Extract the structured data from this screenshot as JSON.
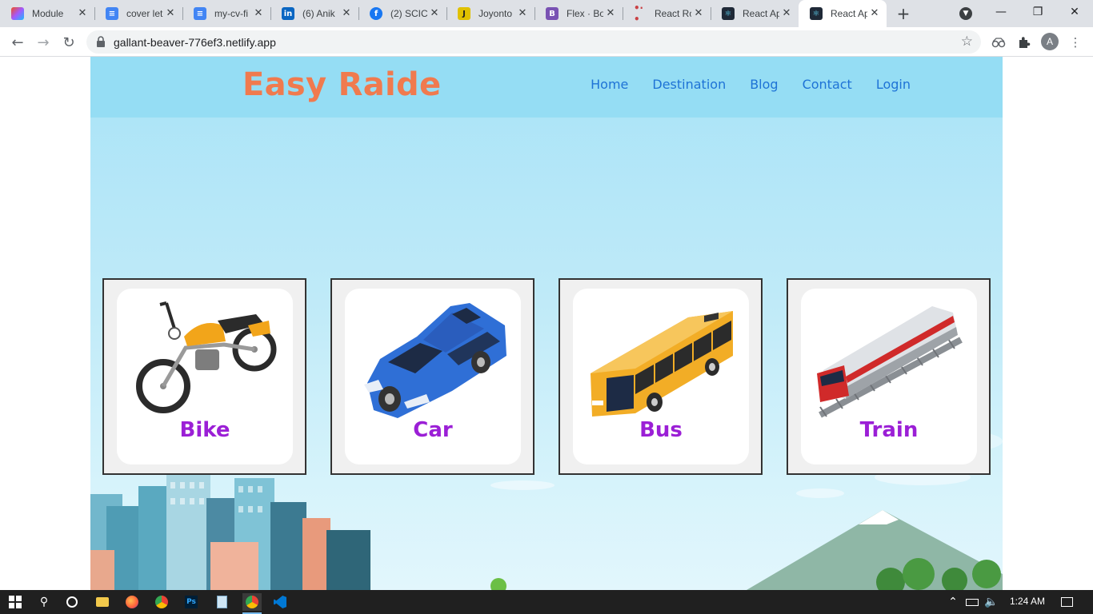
{
  "tabs": [
    {
      "title": "Module",
      "icon": "figma-icon",
      "color": "#a259ff"
    },
    {
      "title": "cover let",
      "icon": "docs-icon",
      "color": "#4285f4"
    },
    {
      "title": "my-cv-fi",
      "icon": "docs-icon",
      "color": "#4285f4"
    },
    {
      "title": "(6) Anik",
      "icon": "linkedin-icon",
      "color": "#0a66c2"
    },
    {
      "title": "(2) SCIC",
      "icon": "facebook-icon",
      "color": "#1877f2"
    },
    {
      "title": "Joyonto",
      "icon": "joyonto-icon",
      "color": "#e0c100"
    },
    {
      "title": "Flex · Bo",
      "icon": "bootstrap-icon",
      "color": "#7952b3"
    },
    {
      "title": "React Ro",
      "icon": "react-router-icon",
      "color": "#ca4245"
    },
    {
      "title": "React Ap",
      "icon": "react-icon",
      "color": "#1f2937"
    },
    {
      "title": "React Ap",
      "icon": "react-icon",
      "color": "#1f2937"
    }
  ],
  "address_bar": {
    "url": "gallant-beaver-776ef3.netlify.app"
  },
  "profile": {
    "initial": "A"
  },
  "site": {
    "brand": "Easy Raide",
    "nav": [
      "Home",
      "Destination",
      "Blog",
      "Contact",
      "Login"
    ]
  },
  "vehicles": [
    {
      "label": "Bike"
    },
    {
      "label": "Car"
    },
    {
      "label": "Bus"
    },
    {
      "label": "Train"
    }
  ],
  "taskbar": {
    "time": "1:24 AM"
  },
  "colors": {
    "brand": "#f07a4e",
    "nav_link": "#1e73d6",
    "card_label": "#9b1fd6",
    "header_bg": "#95ddf4"
  }
}
